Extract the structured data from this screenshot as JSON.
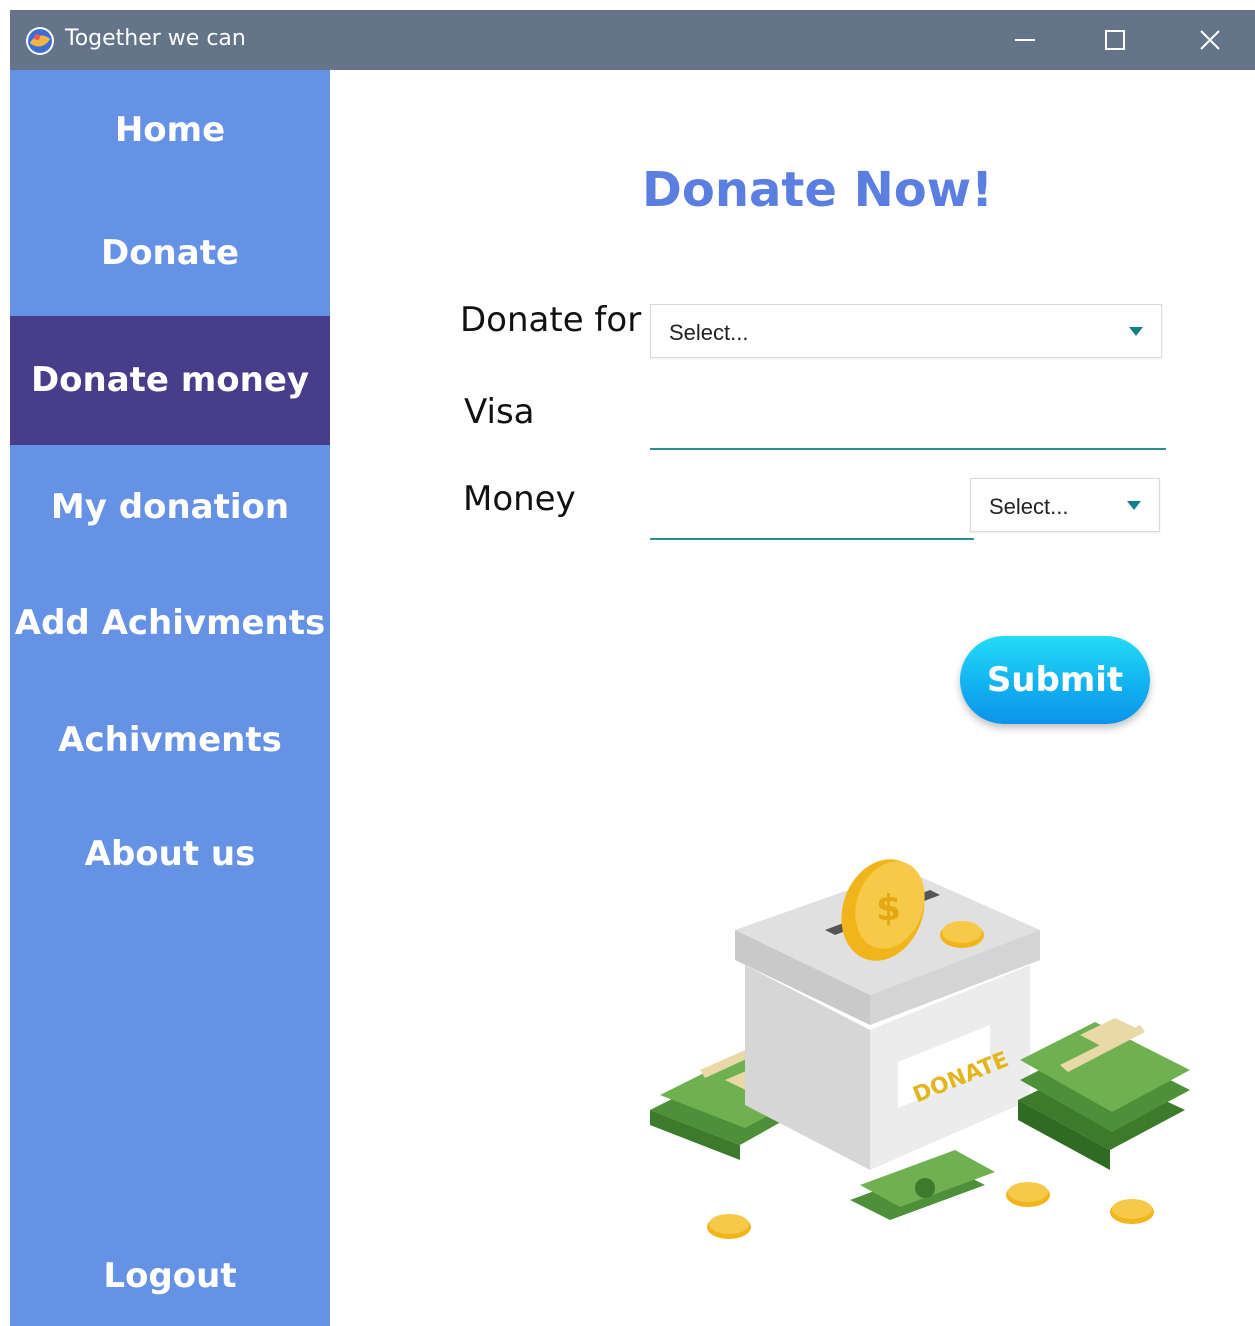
{
  "window": {
    "title": "Together we can"
  },
  "sidebar": {
    "items": [
      {
        "label": "Home"
      },
      {
        "label": "Donate"
      },
      {
        "label": "Donate money",
        "active": true
      },
      {
        "label": "My donation"
      },
      {
        "label": "Add Achivments"
      },
      {
        "label": "Achivments"
      },
      {
        "label": "About us"
      }
    ],
    "logout_label": "Logout"
  },
  "main": {
    "title": "Donate Now!",
    "form": {
      "donate_for": {
        "label": "Donate for",
        "selected": "Select..."
      },
      "visa": {
        "label": "Visa",
        "value": ""
      },
      "money": {
        "label": "Money",
        "value": "",
        "currency_selected": "Select..."
      }
    },
    "submit_label": "Submit",
    "illustration_text": "DONATE"
  },
  "colors": {
    "titlebar": "#64758a",
    "sidebar": "#6692e6",
    "sidebar_active": "#483d8b",
    "title": "#5b7fe0",
    "accent_underline": "#2a8f95",
    "submit": "#11aef0"
  }
}
